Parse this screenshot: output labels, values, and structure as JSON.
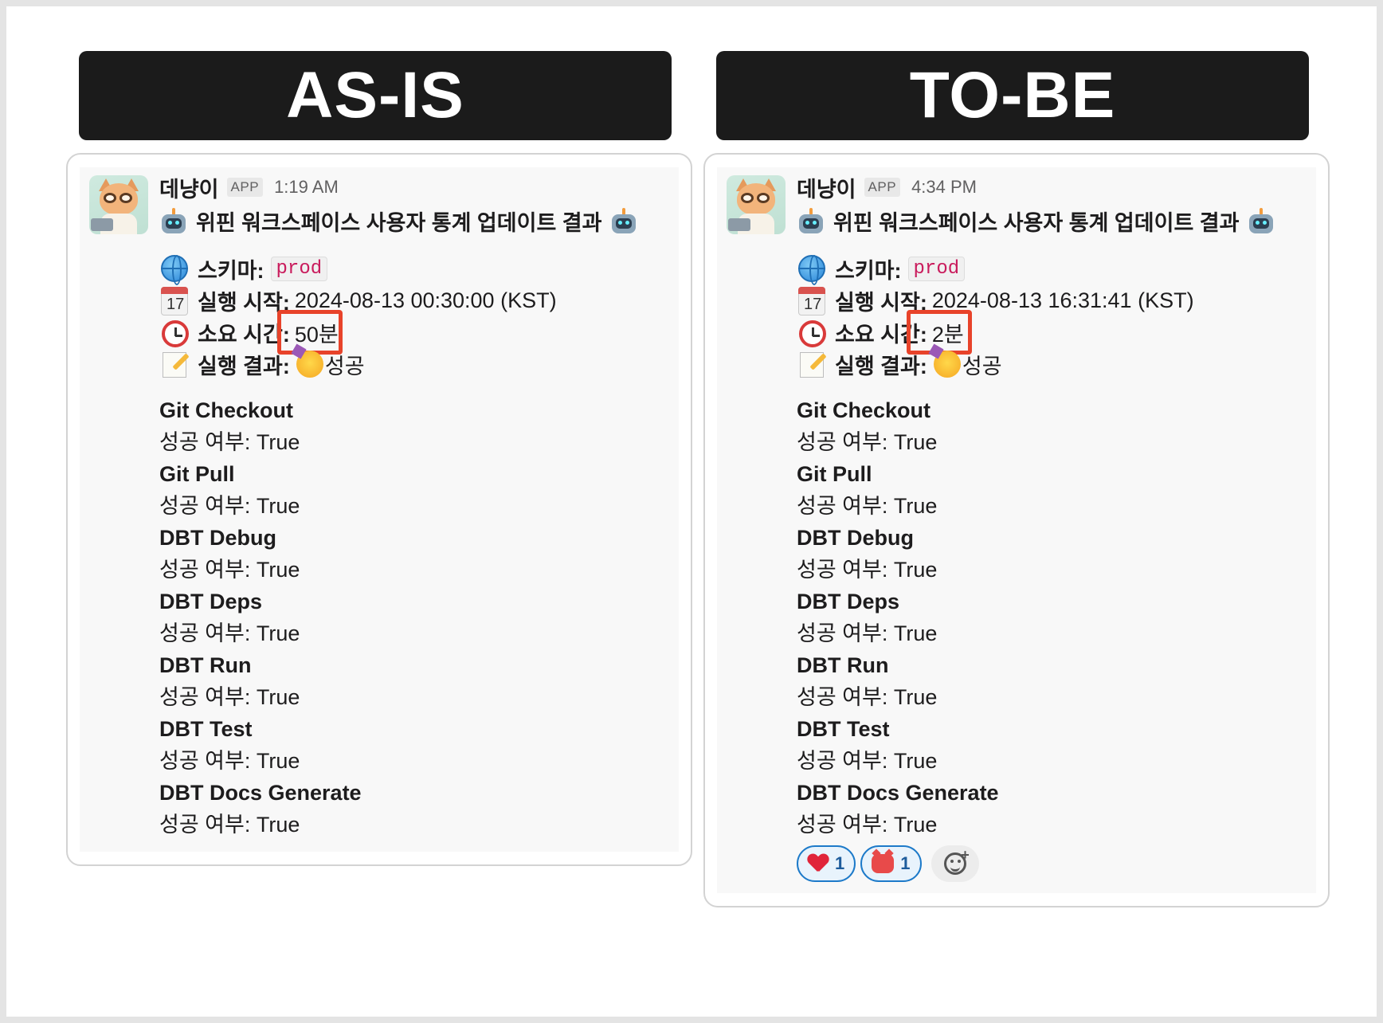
{
  "panels": [
    {
      "banner": "AS-IS",
      "sender": "데냥이",
      "badge": "APP",
      "time": "1:19 AM",
      "title": "위핀 워크스페이스 사용자 통계 업데이트 결과",
      "schema_label": "스키마:",
      "schema_value": "prod",
      "start_label": "실행 시작:",
      "start_value": "2024-08-13 00:30:00 (KST)",
      "calendar_day": "17",
      "duration_label": "소요 시간:",
      "duration_value": "50분",
      "result_label": "실행 결과:",
      "result_value": "성공",
      "steps": [
        {
          "name": "Git Checkout",
          "status": "성공 여부: True"
        },
        {
          "name": "Git Pull",
          "status": "성공 여부: True"
        },
        {
          "name": "DBT Debug",
          "status": "성공 여부: True"
        },
        {
          "name": "DBT Deps",
          "status": "성공 여부: True"
        },
        {
          "name": "DBT Run",
          "status": "성공 여부: True"
        },
        {
          "name": "DBT Test",
          "status": "성공 여부: True"
        },
        {
          "name": "DBT Docs Generate",
          "status": "성공 여부: True"
        }
      ]
    },
    {
      "banner": "TO-BE",
      "sender": "데냥이",
      "badge": "APP",
      "time": "4:34 PM",
      "title": "위핀 워크스페이스 사용자 통계 업데이트 결과",
      "schema_label": "스키마:",
      "schema_value": "prod",
      "start_label": "실행 시작:",
      "start_value": "2024-08-13 16:31:41 (KST)",
      "calendar_day": "17",
      "duration_label": "소요 시간:",
      "duration_value": "2분",
      "result_label": "실행 결과:",
      "result_value": "성공",
      "steps": [
        {
          "name": "Git Checkout",
          "status": "성공 여부: True"
        },
        {
          "name": "Git Pull",
          "status": "성공 여부: True"
        },
        {
          "name": "DBT Debug",
          "status": "성공 여부: True"
        },
        {
          "name": "DBT Deps",
          "status": "성공 여부: True"
        },
        {
          "name": "DBT Run",
          "status": "성공 여부: True"
        },
        {
          "name": "DBT Test",
          "status": "성공 여부: True"
        },
        {
          "name": "DBT Docs Generate",
          "status": "성공 여부: True"
        }
      ],
      "reactions": [
        {
          "icon": "heart-icon",
          "count": "1"
        },
        {
          "icon": "pig-icon",
          "count": "1"
        }
      ]
    }
  ],
  "colors": {
    "banner_bg": "#1b1b1b",
    "highlight": "#e8432a",
    "code_text": "#c91b5c",
    "reaction_border": "#1d7ac9"
  }
}
